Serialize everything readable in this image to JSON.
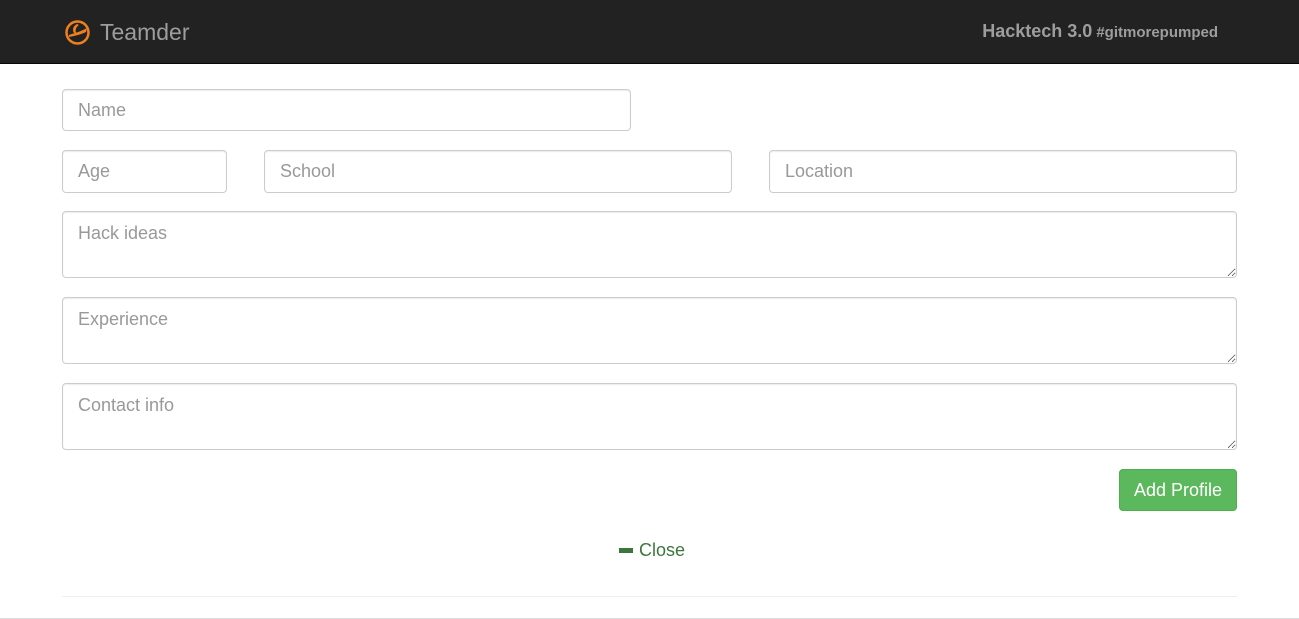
{
  "navbar": {
    "brand": "Teamder",
    "event_name": "Hacktech 3.0",
    "event_tag": "#gitmorepumped",
    "icon": "flame-logo-icon",
    "accent_color": "#f0801f"
  },
  "form": {
    "name_placeholder": "Name",
    "age_placeholder": "Age",
    "school_placeholder": "School",
    "location_placeholder": "Location",
    "hack_ideas_placeholder": "Hack ideas",
    "experience_placeholder": "Experience",
    "contact_placeholder": "Contact info",
    "submit_label": "Add Profile",
    "submit_color": "#5cb85c"
  },
  "close": {
    "label": "Close",
    "icon": "minus-icon",
    "color": "#3c763d"
  }
}
